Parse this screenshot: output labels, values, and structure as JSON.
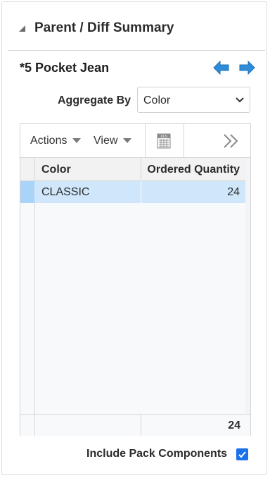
{
  "panel": {
    "title": "Parent / Diff Summary",
    "collapse_icon": "collapse-triangle-icon"
  },
  "item": {
    "title": "*5 Pocket Jean",
    "prev_icon": "arrow-left-icon",
    "next_icon": "arrow-right-icon",
    "arrow_color": "#2e8cd9"
  },
  "aggregate": {
    "label": "Aggregate By",
    "value": "Color"
  },
  "toolbar": {
    "actions_label": "Actions",
    "view_label": "View",
    "export_icon": "xls-export-icon",
    "overflow_icon": "double-chevron-right-icon"
  },
  "table": {
    "columns": [
      "Color",
      "Ordered Quantity"
    ],
    "rows": [
      {
        "color": "CLASSIC",
        "ordered_quantity": "24"
      }
    ],
    "footer_total": "24",
    "selected_row_color": "#cfe6fb"
  },
  "include_pack": {
    "label": "Include Pack Components",
    "checked": true,
    "accent": "#1a73e8"
  }
}
